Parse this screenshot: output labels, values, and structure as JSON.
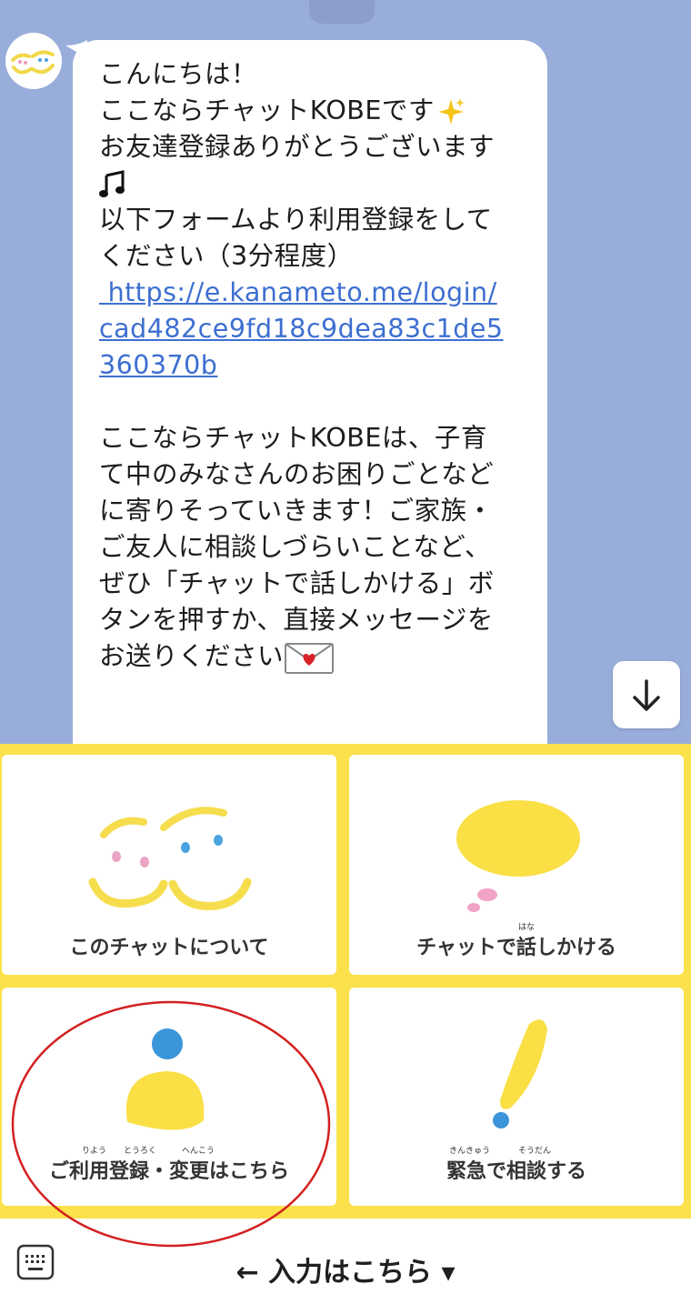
{
  "chat": {
    "lines": [
      "こんにちは！",
      "ここならチャットKOBEです",
      "お友達登録ありがとうございます",
      "",
      "以下フォームより利用登録をして",
      "ください（3分程度）",
      "ここならチャットKOBEは、子育",
      "て中のみなさんのお困りごとなど",
      "に寄りそっていきます！ご家族・",
      "ご友人に相談しづらいことなど、",
      "ぜひ「チャットで話しかける」ボ",
      "タンを押すか、直接メッセージを",
      "お送りください"
    ],
    "link_lines": [
      " https://e.kanameto.me/login/",
      "cad482ce9fd18c9dea83c1de5",
      "360370b"
    ],
    "emoji": {
      "sparkle": "sparkle-icon",
      "music": "music-note-icon",
      "mail": "heart-envelope-icon"
    }
  },
  "menu": {
    "tiles": [
      {
        "label": "このチャットについて"
      },
      {
        "label": "チャットで話しかける",
        "ruby": "はな"
      },
      {
        "label": "ご利用登録・変更はこちら",
        "ruby": [
          "りよう",
          "とうろく",
          "へんこう"
        ]
      },
      {
        "label": "緊急で相談する",
        "ruby": [
          "きんきゅう",
          "そうだん"
        ]
      }
    ]
  },
  "inputbar": {
    "label": "← 入力はこちら ▾",
    "keyboard_icon": "keyboard-icon"
  },
  "colors": {
    "chat_bg": "#99addb",
    "menu_bg": "#fbe14b",
    "link": "#3d6fd1",
    "annotation": "#d32020"
  }
}
